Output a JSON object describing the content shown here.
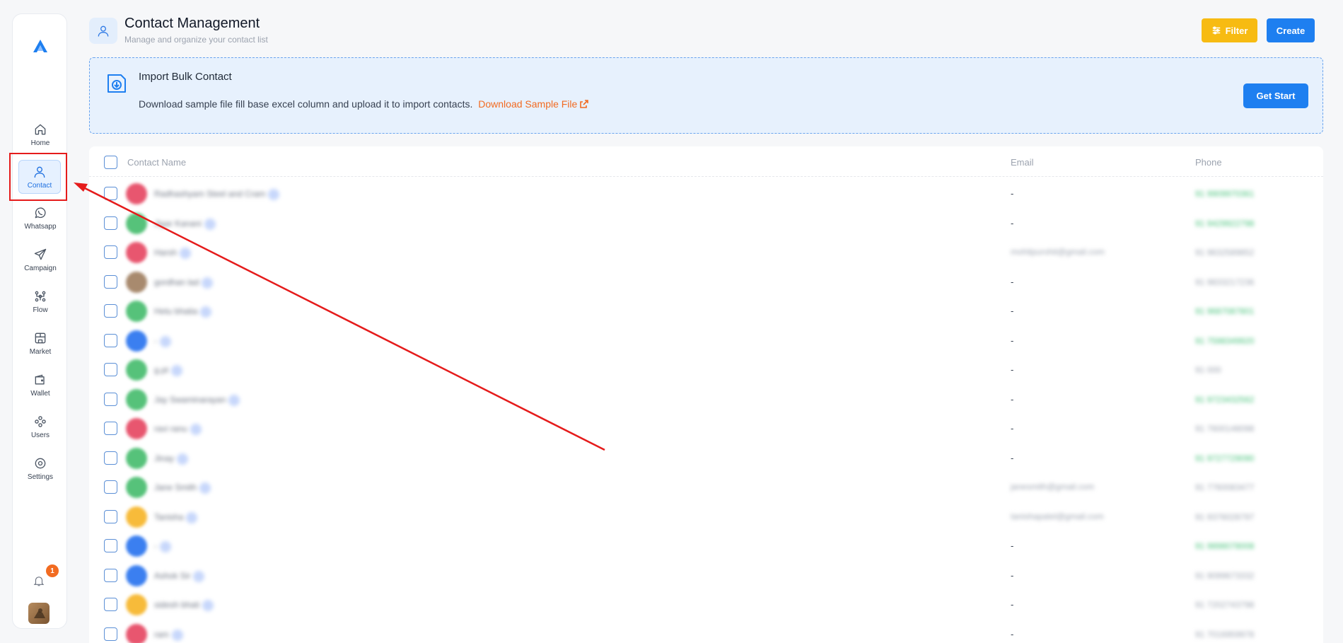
{
  "nav": {
    "items": [
      {
        "label": "Home",
        "icon": "home-icon"
      },
      {
        "label": "Contact",
        "icon": "contact-icon",
        "active": true
      },
      {
        "label": "Whatsapp",
        "icon": "whatsapp-icon"
      },
      {
        "label": "Campaign",
        "icon": "campaign-icon"
      },
      {
        "label": "Flow",
        "icon": "flow-icon"
      },
      {
        "label": "Market",
        "icon": "market-icon"
      },
      {
        "label": "Wallet",
        "icon": "wallet-icon"
      },
      {
        "label": "Users",
        "icon": "users-icon"
      },
      {
        "label": "Settings",
        "icon": "settings-icon"
      }
    ],
    "notification_count": "1"
  },
  "header": {
    "title": "Contact Management",
    "subtitle": "Manage and organize your contact list",
    "filter_label": "Filter",
    "create_label": "Create"
  },
  "import": {
    "title": "Import Bulk Contact",
    "description": "Download sample file fill base excel column and upload it to import contacts.",
    "link_label": "Download Sample File",
    "button_label": "Get Start"
  },
  "table": {
    "columns": [
      "Contact Name",
      "Email",
      "Phone"
    ],
    "rows": [
      {
        "name": "Radhashyam Steel and Cram",
        "email": "-",
        "phone": "91 9909970361",
        "avatar": "#e8566f",
        "phone_green": true
      },
      {
        "name": "Jigar Kanani",
        "email": "-",
        "phone": "91 9429922798",
        "avatar": "#56c27a",
        "phone_green": true
      },
      {
        "name": "Harsh",
        "email": "mohitpurohit@gmail.com",
        "phone": "91 9632589852",
        "avatar": "#e8566f",
        "phone_green": false
      },
      {
        "name": "gordhan lad",
        "email": "-",
        "phone": "91 9833217236",
        "avatar": "#a88a6e",
        "phone_green": false
      },
      {
        "name": "Hetu bhatia",
        "email": "-",
        "phone": "91 9687087801",
        "avatar": "#56c27a",
        "phone_green": true
      },
      {
        "name": "-",
        "email": "-",
        "phone": "91 7598349920",
        "avatar": "#3b7ff0",
        "phone_green": true
      },
      {
        "name": "g.pt",
        "email": "-",
        "phone": "91 000",
        "avatar": "#56c27a",
        "phone_green": false
      },
      {
        "name": "Jay Swaminarayan",
        "email": "-",
        "phone": "91 9723432562",
        "avatar": "#56c27a",
        "phone_green": true
      },
      {
        "name": "ravi ranu",
        "email": "-",
        "phone": "91 7600148098",
        "avatar": "#e8566f",
        "phone_green": false
      },
      {
        "name": "Jinay",
        "email": "-",
        "phone": "91 9727729090",
        "avatar": "#56c27a",
        "phone_green": true
      },
      {
        "name": "Jane Smith",
        "email": "janesmith@gmail.com",
        "phone": "91 7760083477",
        "avatar": "#56c27a",
        "phone_green": false
      },
      {
        "name": "Tanisha",
        "email": "tanishapatel@gmail.com",
        "phone": "91 9376028797",
        "avatar": "#f7bb3a",
        "phone_green": false
      },
      {
        "name": "-",
        "email": "-",
        "phone": "91 9898078008",
        "avatar": "#3b7ff0",
        "phone_green": true
      },
      {
        "name": "Ashok Sir",
        "email": "-",
        "phone": "91 9099673332",
        "avatar": "#3b7ff0",
        "phone_green": false
      },
      {
        "name": "sidesh bhati",
        "email": "-",
        "phone": "91 7202743798",
        "avatar": "#f7bb3a",
        "phone_green": false
      },
      {
        "name": "ram",
        "email": "-",
        "phone": "91 7016959978",
        "avatar": "#e8566f",
        "phone_green": false
      }
    ]
  }
}
